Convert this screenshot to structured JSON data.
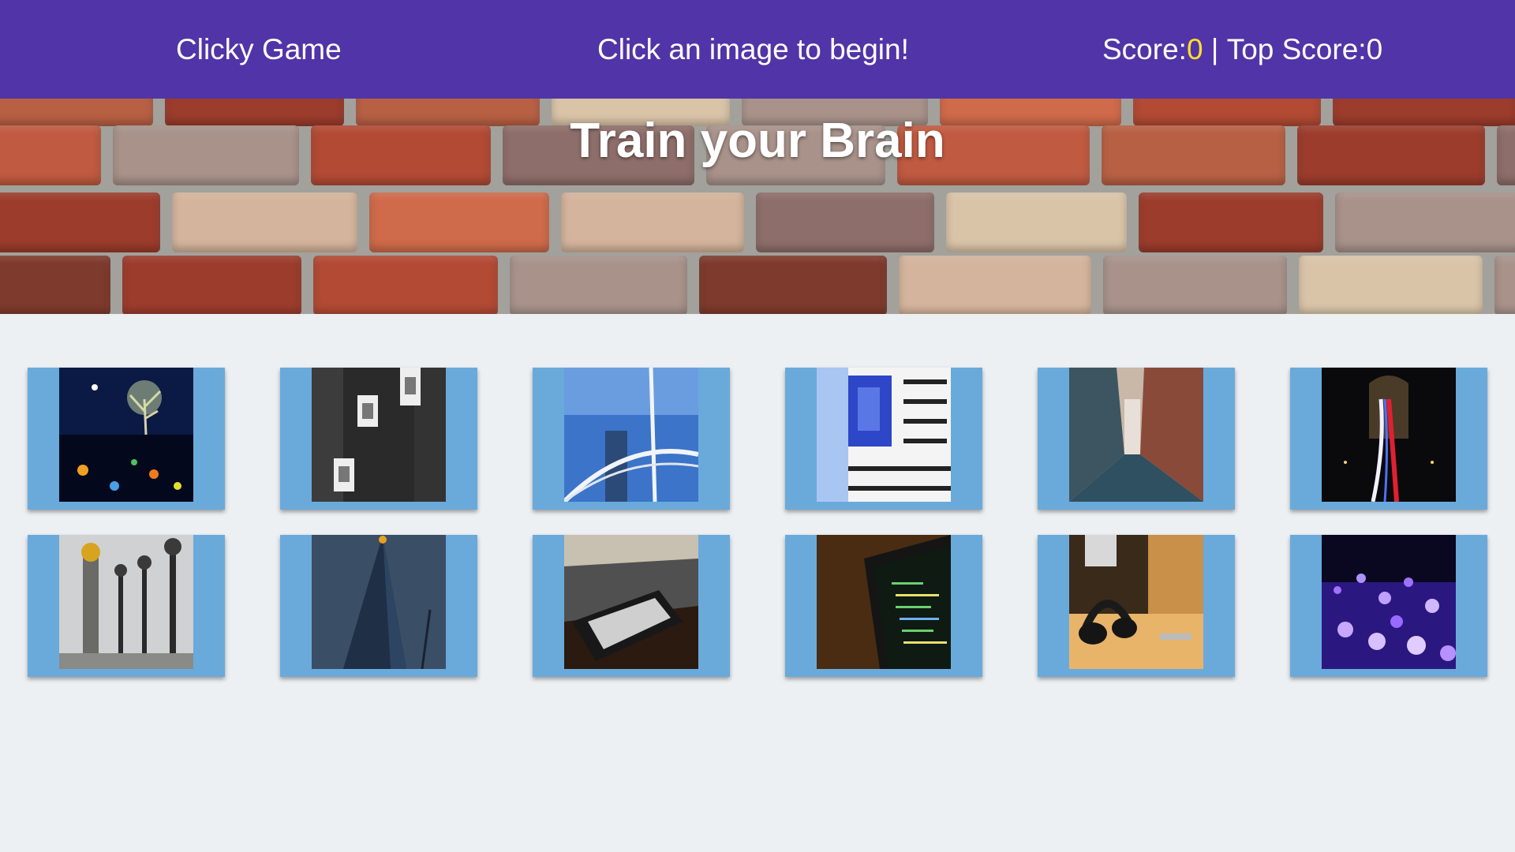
{
  "navbar": {
    "brand": "Clicky Game",
    "message": "Click an image to begin!",
    "score_label": "Score: ",
    "score": "0",
    "separator": " | ",
    "top_score_label": "Top Score: ",
    "top_score": "0"
  },
  "hero": {
    "title": "Train your Brain"
  },
  "colors": {
    "navbar": "#5134a7",
    "score_highlight": "#ffe02a",
    "card_background": "#6aaadb",
    "page_background": "#ecf0f3"
  },
  "cards": [
    {
      "image": "night-pond-tree-lights"
    },
    {
      "image": "elevator-building-facade"
    },
    {
      "image": "white-bridge-arch-tower"
    },
    {
      "image": "blue-white-office-building"
    },
    {
      "image": "city-street-brick-buildings"
    },
    {
      "image": "bridge-light-trails-night"
    },
    {
      "image": "ornate-bridge-lampposts"
    },
    {
      "image": "glass-skyscraper-fog"
    },
    {
      "image": "smartphone-on-laptop"
    },
    {
      "image": "laptop-code-screen"
    },
    {
      "image": "headphones-on-desk"
    },
    {
      "image": "purple-fiber-optic-lights"
    }
  ]
}
